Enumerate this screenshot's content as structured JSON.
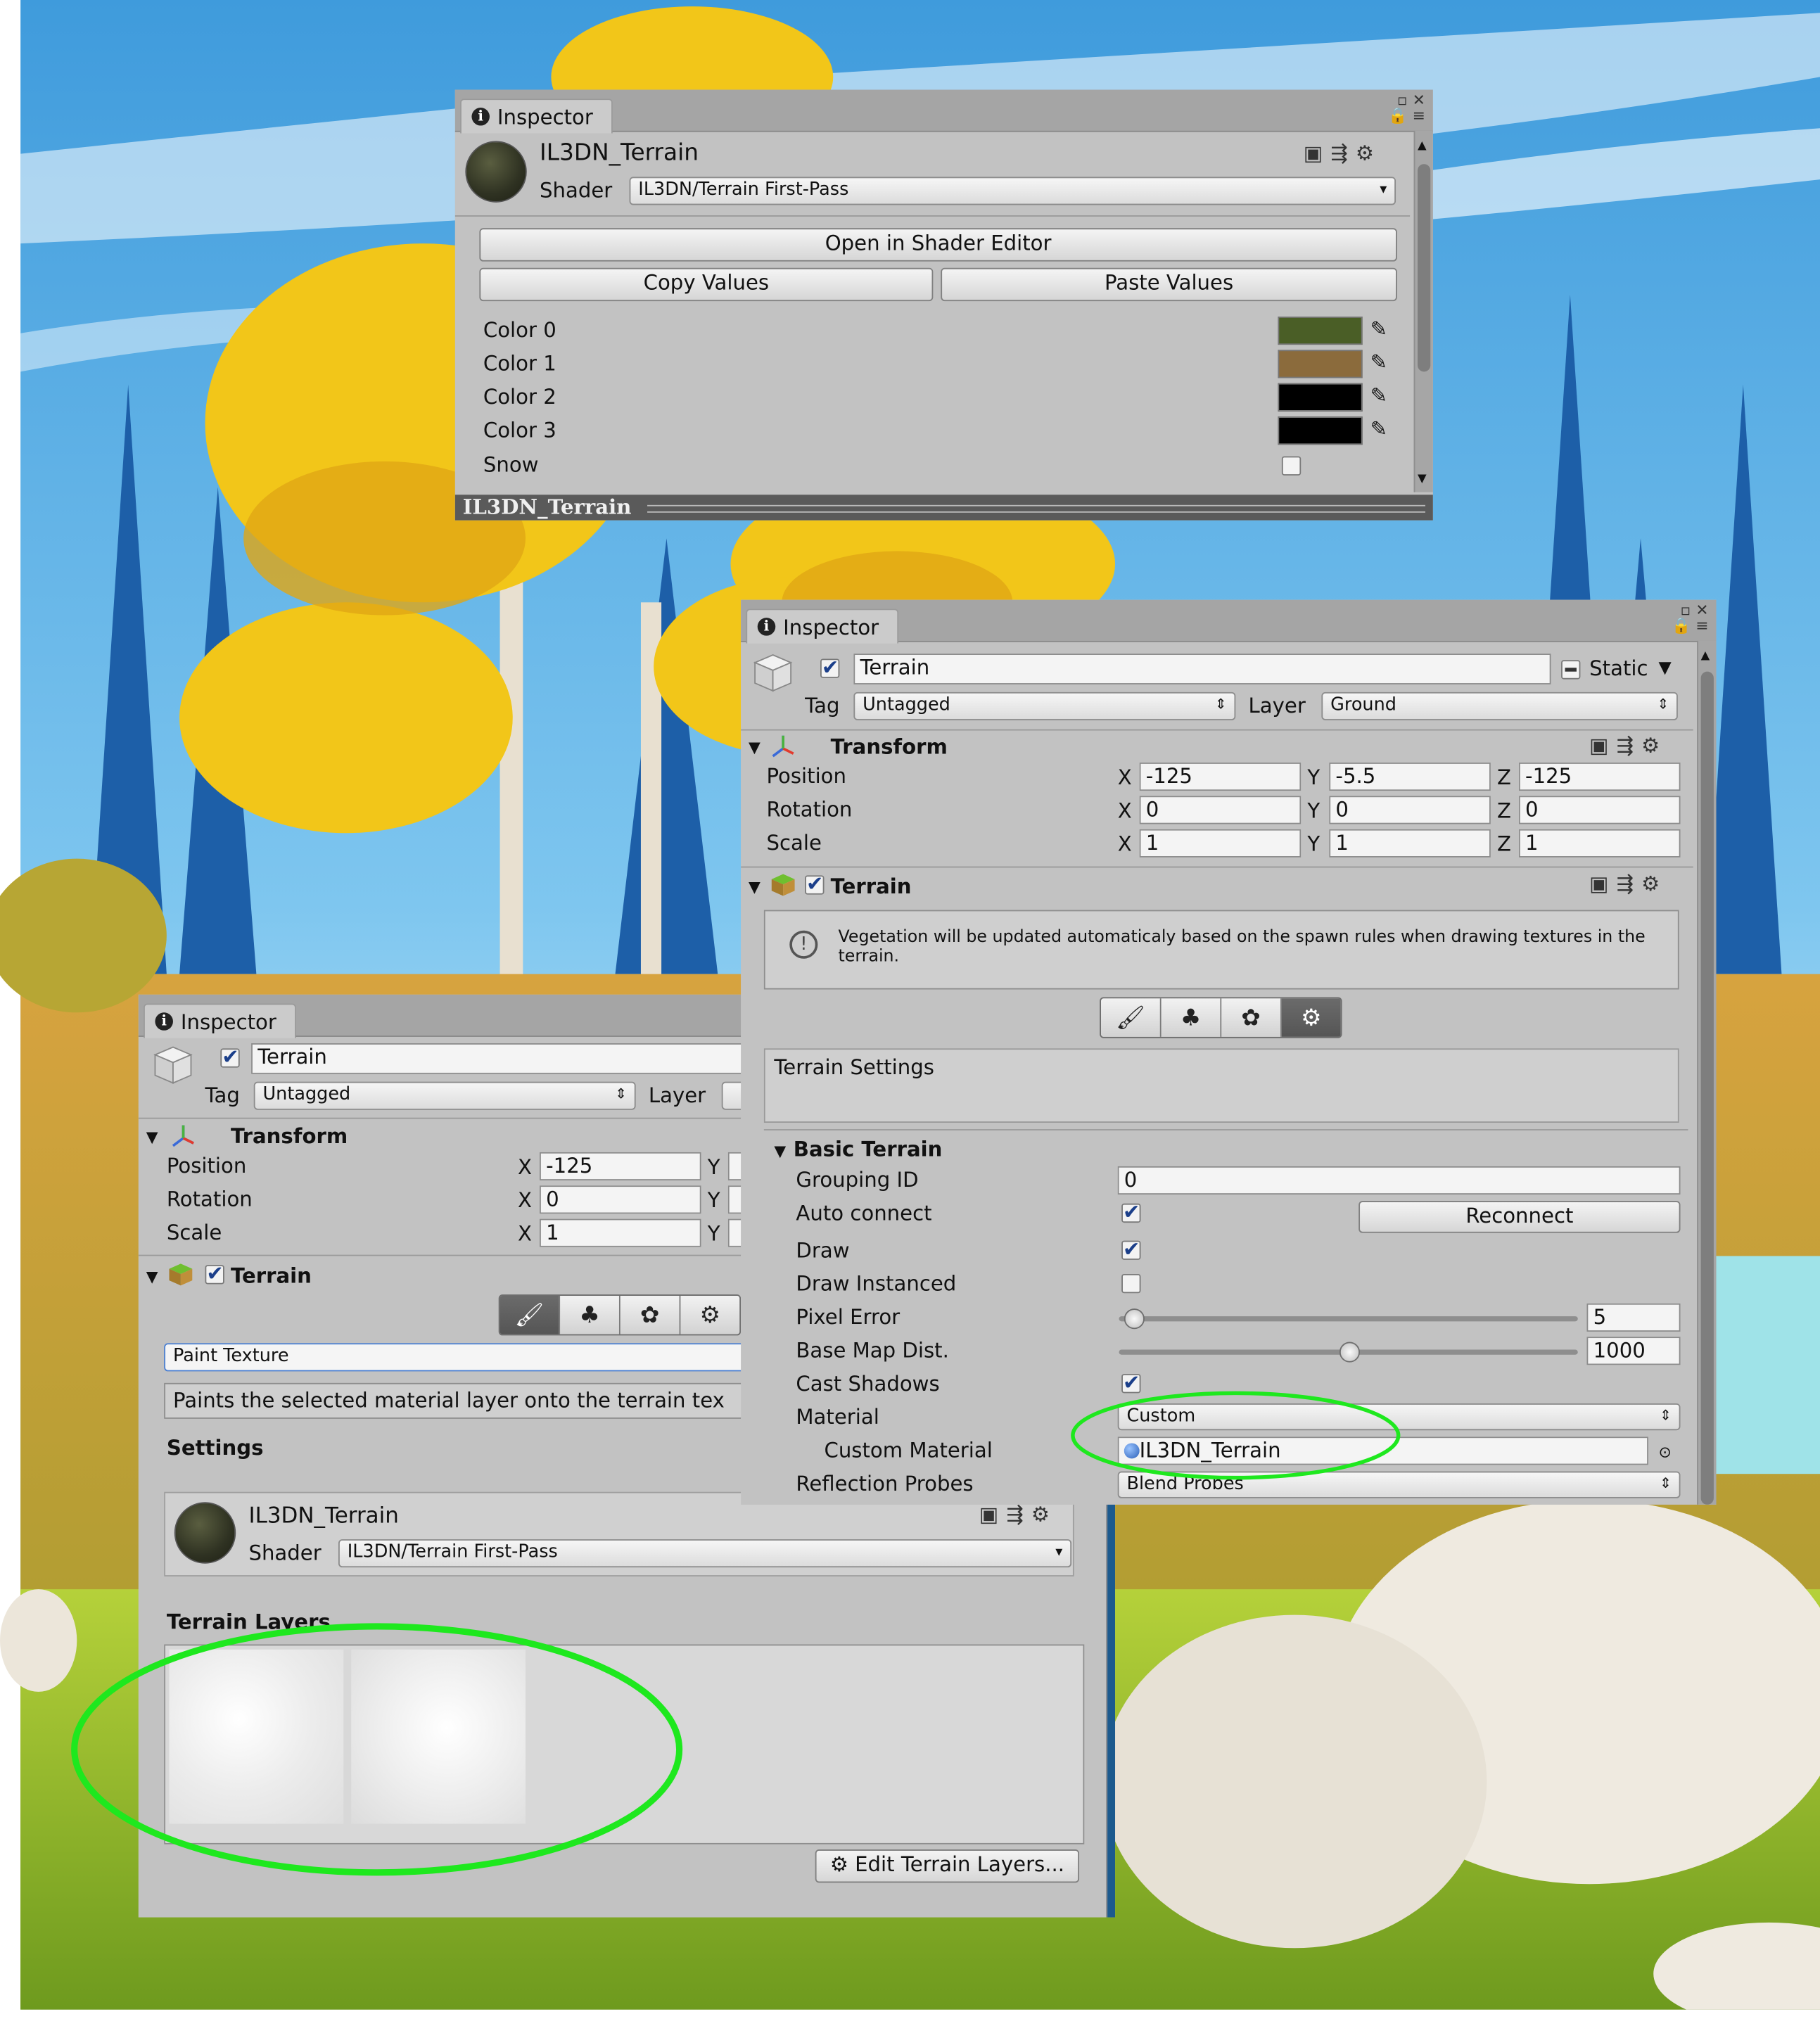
{
  "colors": {
    "highlight_ellipse": "#1ee81e",
    "panel_bg": "#c2c2c2",
    "swatch_green": "#4a5e26",
    "swatch_brown": "#8b6b3c"
  },
  "top_inspector": {
    "tab_label": "Inspector",
    "material_name": "IL3DN_Terrain",
    "shader_label": "Shader",
    "shader_value": "IL3DN/Terrain First-Pass",
    "open_shader_editor": "Open in Shader Editor",
    "copy_values": "Copy Values",
    "paste_values": "Paste Values",
    "properties": [
      {
        "label": "Color 0",
        "color": "#4a5e26"
      },
      {
        "label": "Color 1",
        "color": "#8b6b3c"
      },
      {
        "label": "Color 2",
        "color": "#000000"
      },
      {
        "label": "Color 3",
        "color": "#000000"
      }
    ],
    "snow_label": "Snow",
    "snow_checked": false,
    "footer_title": "IL3DN_Terrain"
  },
  "right_inspector": {
    "tab_label": "Inspector",
    "object_name": "Terrain",
    "static_label": "Static",
    "tag_label": "Tag",
    "tag_value": "Untagged",
    "layer_label": "Layer",
    "layer_value": "Ground",
    "transform_title": "Transform",
    "transform": [
      {
        "label": "Position",
        "x": "-125",
        "y": "-5.5",
        "z": "-125"
      },
      {
        "label": "Rotation",
        "x": "0",
        "y": "0",
        "z": "0"
      },
      {
        "label": "Scale",
        "x": "1",
        "y": "1",
        "z": "1"
      }
    ],
    "axis_x": "X",
    "axis_y": "Y",
    "axis_z": "Z",
    "terrain_title": "Terrain",
    "help_text": "Vegetation will be updated automaticaly based on the spawn rules when drawing textures in the terrain.",
    "settings_box_label": "Terrain Settings",
    "basic_terrain_title": "Basic Terrain",
    "grouping_id_label": "Grouping ID",
    "grouping_id_value": "0",
    "auto_connect_label": "Auto connect",
    "reconnect_label": "Reconnect",
    "draw_label": "Draw",
    "draw_instanced_label": "Draw Instanced",
    "pixel_error_label": "Pixel Error",
    "pixel_error_value": "5",
    "pixel_error_fraction": 0.03,
    "base_map_label": "Base Map Dist.",
    "base_map_value": "1000",
    "base_map_fraction": 0.5,
    "cast_shadows_label": "Cast Shadows",
    "material_label": "Material",
    "material_value": "Custom",
    "custom_material_label": "Custom Material",
    "custom_material_value": "IL3DN_Terrain",
    "reflection_probes_label": "Reflection Probes",
    "reflection_probes_value": "Blend Probes"
  },
  "left_inspector": {
    "tab_label": "Inspector",
    "object_name": "Terrain",
    "tag_label": "Tag",
    "tag_value": "Untagged",
    "layer_label": "Layer",
    "transform_title": "Transform",
    "transform": [
      {
        "label": "Position",
        "x": "-125"
      },
      {
        "label": "Rotation",
        "x": "0"
      },
      {
        "label": "Scale",
        "x": "1"
      }
    ],
    "axis_x": "X",
    "axis_y": "Y",
    "terrain_title": "Terrain",
    "tool_dropdown": "Paint Texture",
    "tool_description": "Paints the selected material layer onto the terrain tex",
    "settings_label": "Settings",
    "material_name": "IL3DN_Terrain",
    "shader_label": "Shader",
    "shader_value": "IL3DN/Terrain First-Pass",
    "terrain_layers_label": "Terrain Layers",
    "edit_layers_button": "Edit Terrain Layers..."
  }
}
